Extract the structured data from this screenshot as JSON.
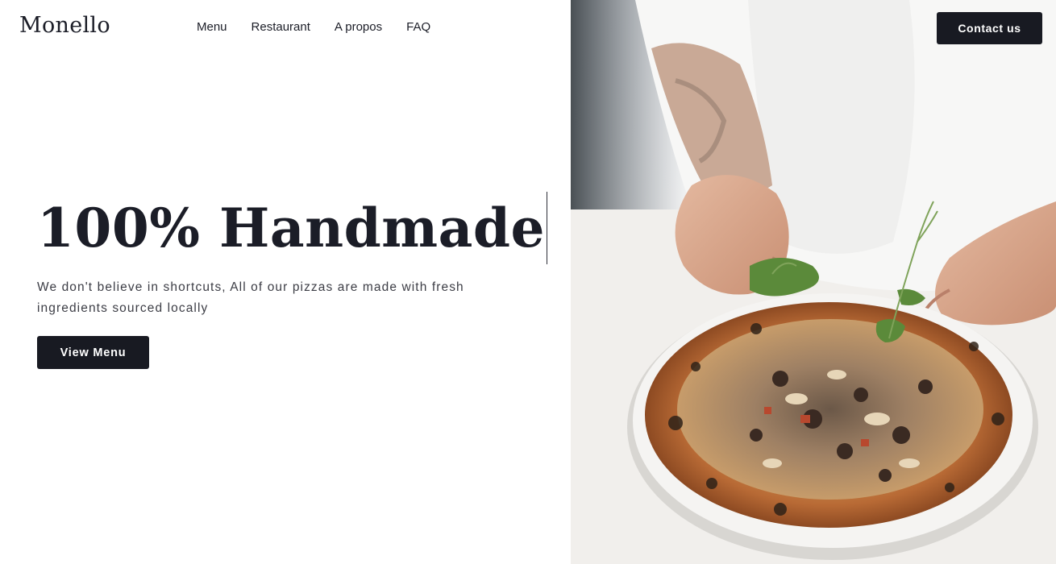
{
  "brand": {
    "name": "Monello"
  },
  "nav": {
    "items": [
      "Menu",
      "Restaurant",
      "A propos",
      "FAQ"
    ],
    "contact_label": "Contact us"
  },
  "hero": {
    "title_highlight": "100",
    "title_rest": "% Handmade",
    "description": "We don't believe in shortcuts, All of our pizzas are made with fresh ingredients sourced locally",
    "cta_label": "View Menu"
  },
  "image": {
    "subject": "chef-garnishing-pizza-photo"
  },
  "colors": {
    "dark": "#181a22",
    "highlight": "#f9e39a",
    "background": "#ffffff"
  }
}
